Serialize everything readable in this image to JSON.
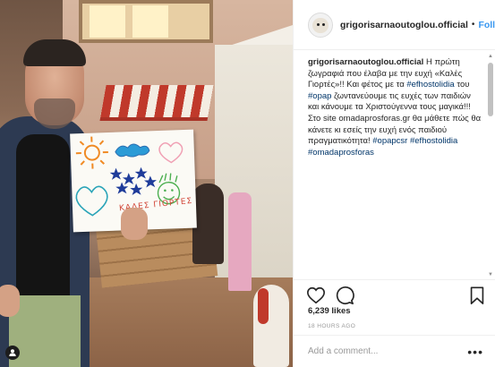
{
  "post": {
    "username": "grigorisarnaoutoglou.official",
    "separator": "•",
    "follow_label": "Follow",
    "caption": {
      "username": "grigorisarnaoutoglou.official",
      "text_1": " Η πρώτη ζωγραφιά που έλαβα με την ευχή «Καλές Γιορτές»!! Και φέτος με τα ",
      "tag_1": "#efhostolidia",
      "text_2": " του ",
      "tag_2": "#opap",
      "text_3": " ζωντανεύουμε τις ευχές των παιδιών και κάνουμε τα Χριστούγεννα τους μαγικά!!! Στο site omadaprosforas.gr θα μάθετε πώς θα κάνετε κι εσείς την ευχή ενός παιδιού πραγματικότητα! ",
      "tag_3": "#opapcsr",
      "tag_4": "#efhostolidia",
      "tag_5": "#omadaprosforas"
    },
    "likes": "6,239 likes",
    "time_ago": "18 HOURS AGO",
    "comment_placeholder": "Add a comment...",
    "more_label": "•••"
  },
  "drawing": {
    "label": "ΚΑΛΕΣ ΓΙΟΡΤΕΣ"
  },
  "icons": {
    "like": "heart-icon",
    "comment": "comment-icon",
    "save": "bookmark-icon",
    "profile_badge": "person-icon"
  },
  "colors": {
    "link": "#3897f0",
    "hashtag": "#003569",
    "accent_red": "#c0392b"
  }
}
